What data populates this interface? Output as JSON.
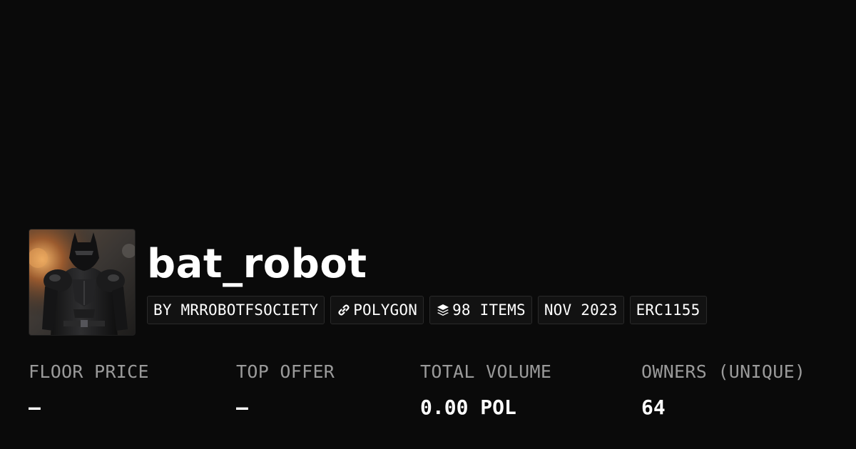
{
  "collection": {
    "name": "bat_robot",
    "avatar_alt": "bat_robot collection image"
  },
  "tags": {
    "creator": "BY MRROBOTFSOCIETY",
    "chain": "POLYGON",
    "items": "98 ITEMS",
    "date": "NOV 2023",
    "standard": "ERC1155",
    "chain_icon": "link-icon",
    "items_icon": "layers-icon"
  },
  "stats": {
    "floor_price": {
      "label": "FLOOR PRICE",
      "value": "–"
    },
    "top_offer": {
      "label": "TOP OFFER",
      "value": "–"
    },
    "total_volume": {
      "label": "TOTAL VOLUME",
      "value": "0.00 POL"
    },
    "owners": {
      "label": "OWNERS (UNIQUE)",
      "value": "64"
    }
  },
  "colors": {
    "background": "#0a0a0a",
    "text": "#ffffff",
    "label": "#9a9a9a",
    "tag_border": "#2a2a2a"
  }
}
